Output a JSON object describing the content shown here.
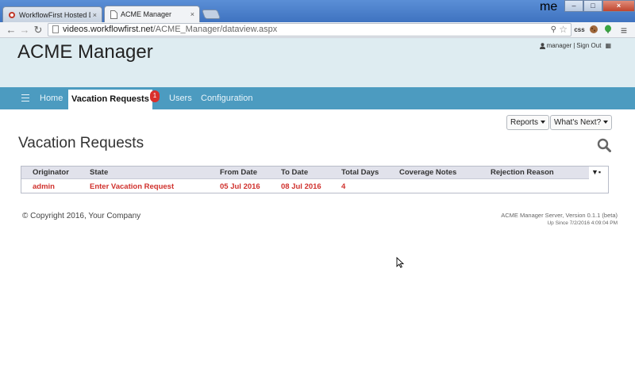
{
  "browser": {
    "tabs": [
      {
        "label": "WorkflowFirst Hosted De",
        "close": "×"
      },
      {
        "label": "ACME Manager",
        "close": "×"
      }
    ],
    "user_badge": "me",
    "window_buttons": {
      "minimize": "–",
      "maximize": "□",
      "close": "×"
    },
    "url_host": "videos.workflowfirst.net",
    "url_path": "/ACME_Manager/dataview.aspx",
    "extension_css": "css"
  },
  "app": {
    "title": "ACME Manager",
    "user": {
      "name": "manager",
      "separator": "|",
      "signout": "Sign Out"
    }
  },
  "nav": {
    "items": [
      {
        "label": "Home"
      },
      {
        "label": "Vacation Requests",
        "badge": "1"
      },
      {
        "label": "Users"
      },
      {
        "label": "Configuration"
      }
    ]
  },
  "actions": {
    "reports": "Reports",
    "whats_next": "What's Next?"
  },
  "page": {
    "title": "Vacation Requests"
  },
  "table": {
    "columns": [
      "Originator",
      "State",
      "From Date",
      "To Date",
      "Total Days",
      "Coverage Notes",
      "Rejection Reason"
    ],
    "menu": "▼▪",
    "rows": [
      {
        "originator": "admin",
        "state": "Enter Vacation Request",
        "from": "05 Jul 2016",
        "to": "08 Jul 2016",
        "days": "4",
        "coverage": "",
        "rejection": ""
      }
    ]
  },
  "footer": {
    "copyright": "© Copyright 2016, Your Company",
    "version": "ACME Manager Server, Version 0.1.1 (beta)",
    "up_since": "Up Since 7/2/2016 4:09:04 PM"
  },
  "colors": {
    "navbar": "#4c9bc0",
    "header": "#deecf1",
    "row_text": "#d0312d",
    "badge": "#d9302c"
  }
}
